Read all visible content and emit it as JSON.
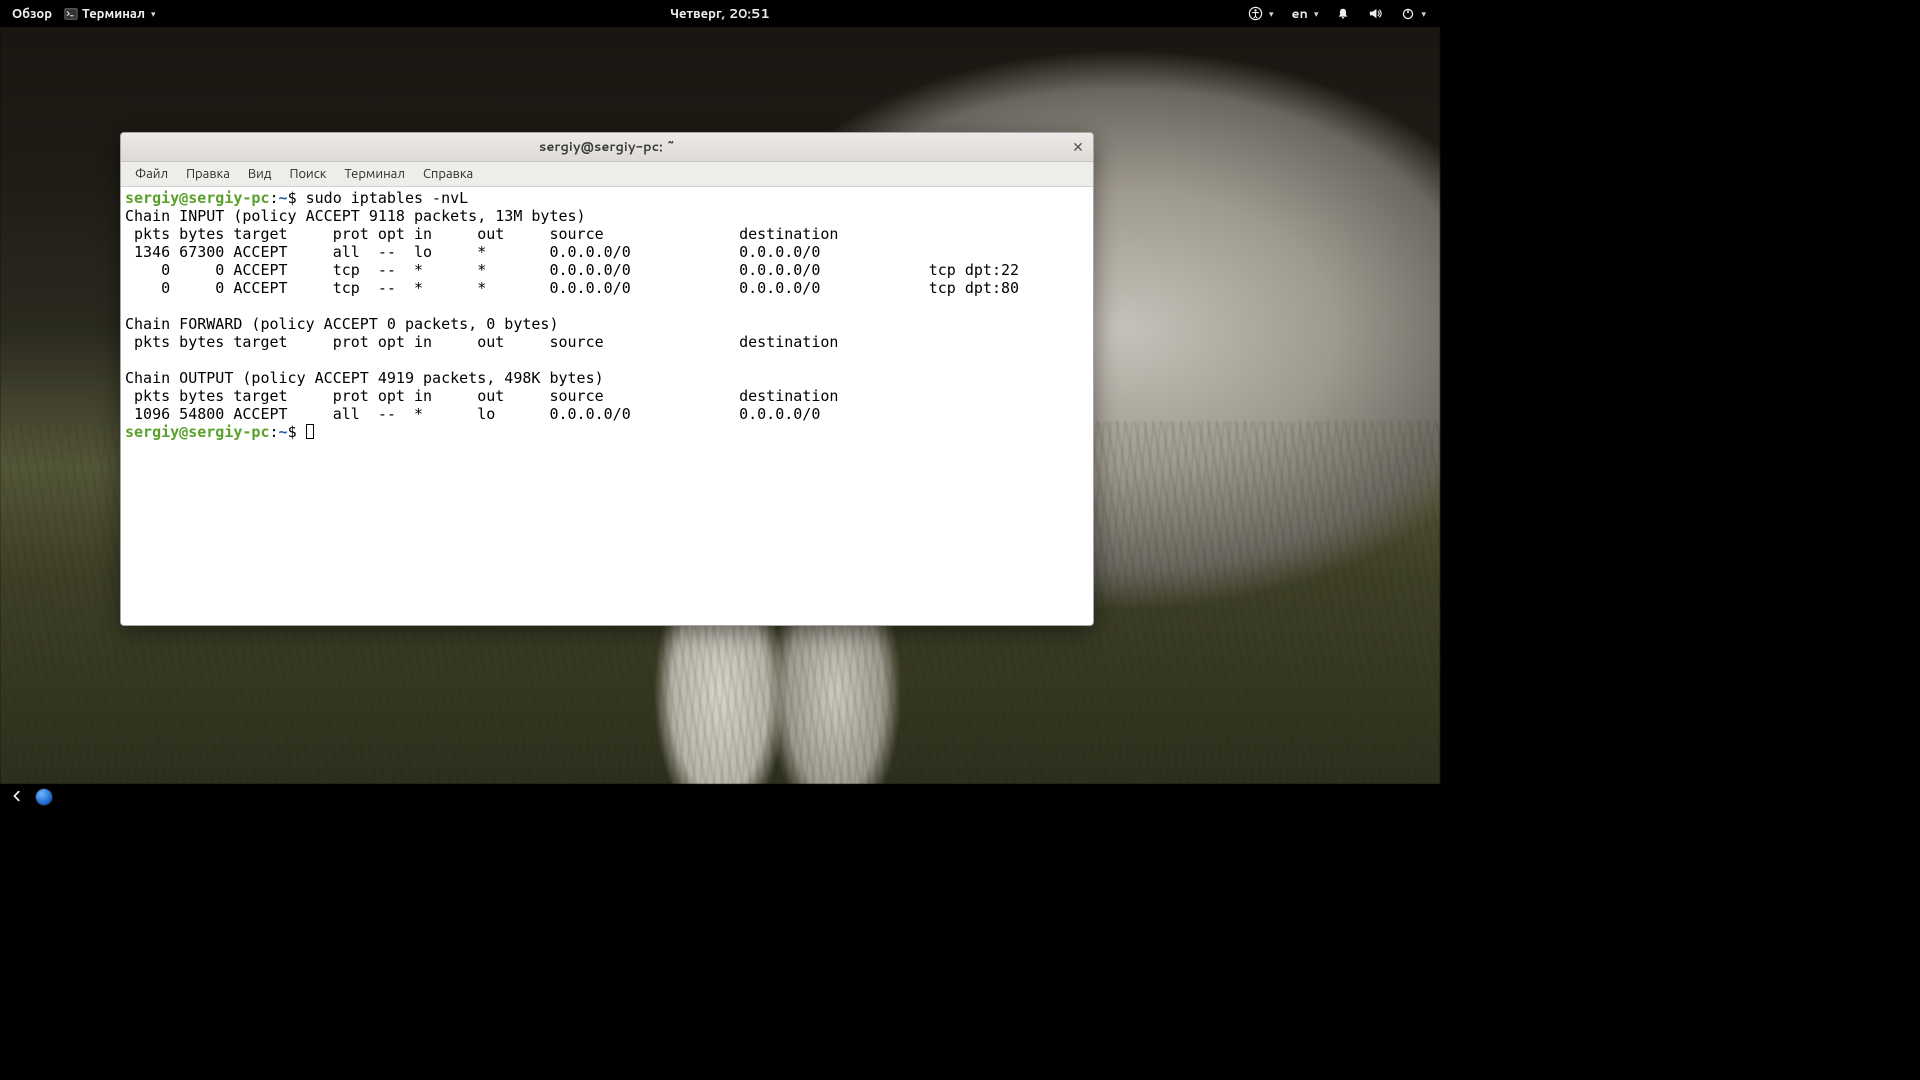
{
  "topbar": {
    "activities": "Обзор",
    "app_label": "Терминал",
    "clock": "Четверг, 20:51",
    "lang": "en"
  },
  "window": {
    "title": "sergiy@sergiy-pc: ~",
    "menus": [
      "Файл",
      "Правка",
      "Вид",
      "Поиск",
      "Терминал",
      "Справка"
    ]
  },
  "terminal": {
    "prompt_user": "sergiy@sergiy-pc",
    "prompt_sep": ":",
    "prompt_path": "~",
    "prompt_sign": "$",
    "command": "sudo iptables -nvL",
    "output": [
      "Chain INPUT (policy ACCEPT 9118 packets, 13M bytes)",
      " pkts bytes target     prot opt in     out     source               destination",
      " 1346 67300 ACCEPT     all  --  lo     *       0.0.0.0/0            0.0.0.0/0",
      "    0     0 ACCEPT     tcp  --  *      *       0.0.0.0/0            0.0.0.0/0            tcp dpt:22",
      "    0     0 ACCEPT     tcp  --  *      *       0.0.0.0/0            0.0.0.0/0            tcp dpt:80",
      "",
      "Chain FORWARD (policy ACCEPT 0 packets, 0 bytes)",
      " pkts bytes target     prot opt in     out     source               destination",
      "",
      "Chain OUTPUT (policy ACCEPT 4919 packets, 498K bytes)",
      " pkts bytes target     prot opt in     out     source               destination",
      " 1096 54800 ACCEPT     all  --  *      lo      0.0.0.0/0            0.0.0.0/0"
    ]
  }
}
